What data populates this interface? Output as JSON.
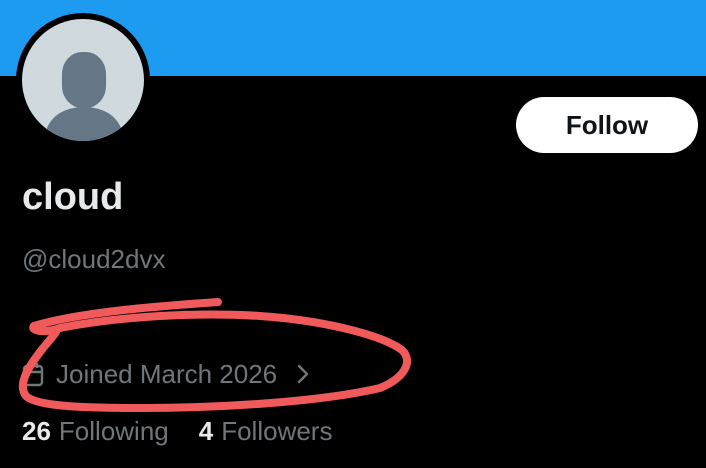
{
  "colors": {
    "banner": "#1d9bf0",
    "background": "#000000",
    "primary_text": "#e7e9ea",
    "secondary_text": "#71767b",
    "avatar_placeholder": "#cfd9de",
    "avatar_silhouette": "#657786",
    "follow_button_bg": "#ffffff",
    "follow_button_text": "#0f1419",
    "annotation_stroke": "#f15a5a"
  },
  "profile": {
    "avatar_icon": "default-avatar-icon",
    "follow_label": "Follow",
    "display_name": "cloud",
    "handle": "@cloud2dvx",
    "joined_icon": "calendar-icon",
    "joined_text": "Joined March 2026",
    "joined_chevron_icon": "chevron-right-icon"
  },
  "stats": {
    "following_count": "26",
    "following_label": "Following",
    "followers_count": "4",
    "followers_label": "Followers"
  },
  "annotation": {
    "shape": "hand-drawn-ellipse",
    "target": "joined-date"
  }
}
